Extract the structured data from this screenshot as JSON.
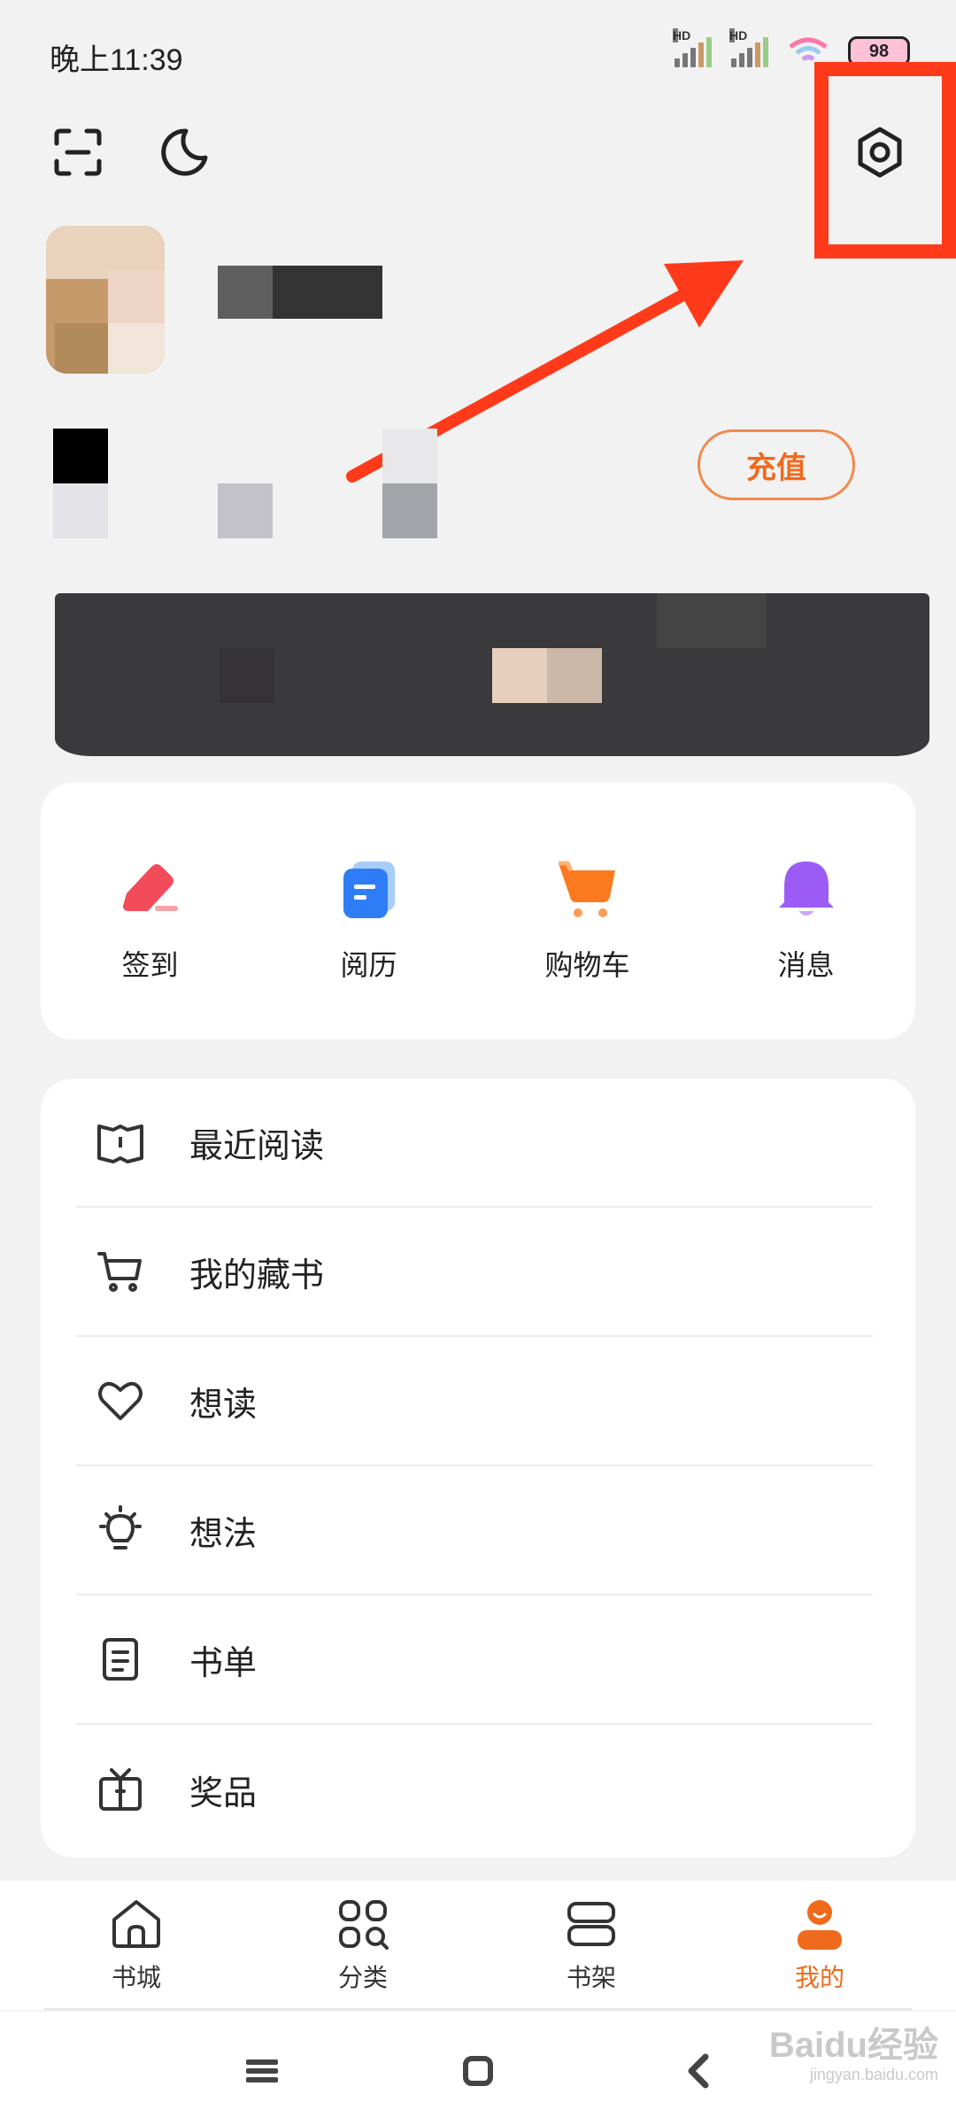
{
  "status_bar": {
    "time": "晚上11:39",
    "signal_label": "HD",
    "battery": "98"
  },
  "profile": {
    "recharge_label": "充值"
  },
  "quick_actions": [
    {
      "label": "签到",
      "icon": "checkin-icon",
      "color": "#f24b5a"
    },
    {
      "label": "阅历",
      "icon": "reading-history-icon",
      "color": "#2f7df6"
    },
    {
      "label": "购物车",
      "icon": "shopping-cart-icon",
      "color": "#fb7a1f"
    },
    {
      "label": "消息",
      "icon": "bell-icon",
      "color": "#9b5cf6"
    }
  ],
  "menu": [
    {
      "label": "最近阅读",
      "icon": "open-book-icon"
    },
    {
      "label": "我的藏书",
      "icon": "cart-icon"
    },
    {
      "label": "想读",
      "icon": "heart-icon"
    },
    {
      "label": "想法",
      "icon": "lightbulb-icon"
    },
    {
      "label": "书单",
      "icon": "list-document-icon"
    },
    {
      "label": "奖品",
      "icon": "gift-icon"
    }
  ],
  "tabs": [
    {
      "label": "书城",
      "icon": "home-icon",
      "active": false
    },
    {
      "label": "分类",
      "icon": "category-icon",
      "active": false
    },
    {
      "label": "书架",
      "icon": "bookshelf-icon",
      "active": false
    },
    {
      "label": "我的",
      "icon": "profile-icon",
      "active": true
    }
  ],
  "colors": {
    "accent": "#f06a1c",
    "annotation": "#ff3a1a",
    "background": "#f2f2f2"
  },
  "watermark": {
    "main": "Baidu经验",
    "sub": "jingyan.baidu.com"
  }
}
